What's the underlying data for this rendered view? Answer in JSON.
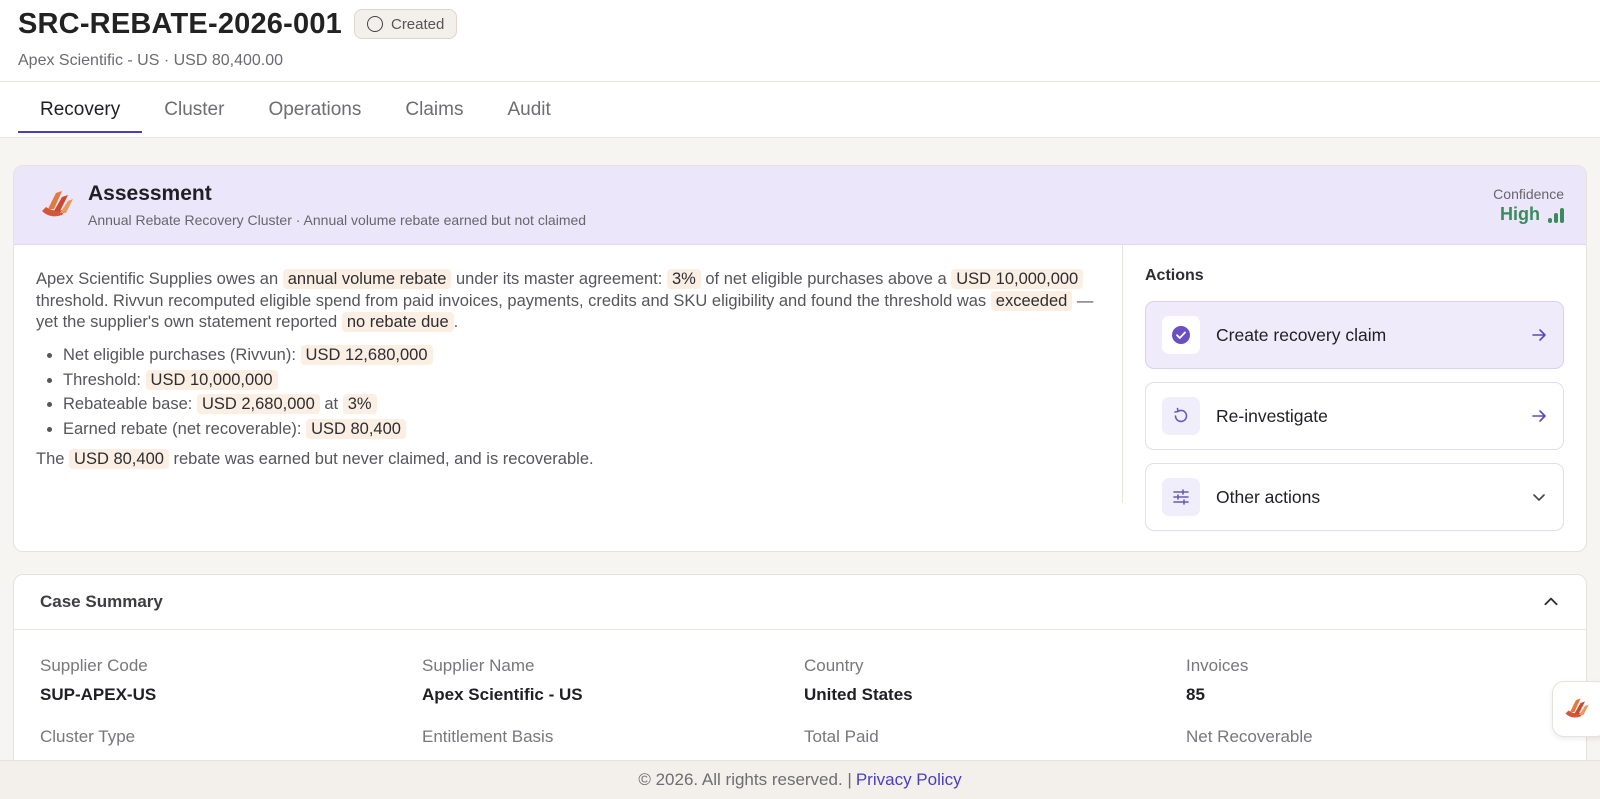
{
  "case": {
    "id": "SRC-REBATE-2026-001",
    "status": "Created",
    "subtitle": "Apex Scientific - US · USD 80,400.00"
  },
  "tabs": [
    "Recovery",
    "Cluster",
    "Operations",
    "Claims",
    "Audit"
  ],
  "assessment": {
    "title": "Assessment",
    "subtitle": "Annual Rebate Recovery Cluster · Annual volume rebate earned but not claimed",
    "confidence_label": "Confidence",
    "confidence_value": "High",
    "para1": {
      "t1": "Apex Scientific Supplies owes an ",
      "h1": "annual volume rebate",
      "t2": " under its master agreement: ",
      "h2": "3%",
      "t3": " of net eligible purchases above a ",
      "h3": "USD 10,000,000",
      "t4": " threshold. Rivvun recomputed eligible spend from paid invoices, payments, credits and SKU eligibility and found the threshold was ",
      "h4": "exceeded",
      "t5": " — yet the supplier's own statement reported ",
      "h5": "no rebate due",
      "t6": "."
    },
    "bullets": [
      {
        "label": "Net eligible purchases (Rivvun): ",
        "value": "USD 12,680,000"
      },
      {
        "label": "Threshold: ",
        "value": "USD 10,000,000"
      },
      {
        "label": "Rebateable base: ",
        "value": "USD 2,680,000",
        "mid": " at ",
        "value2": "3%"
      },
      {
        "label": "Earned rebate (net recoverable): ",
        "value": "USD 80,400"
      }
    ],
    "para2": {
      "t1": "The ",
      "h1": "USD 80,400",
      "t2": " rebate was earned but never claimed, and is recoverable."
    },
    "actions_label": "Actions",
    "actions": [
      {
        "label": "Create recovery claim"
      },
      {
        "label": "Re-investigate"
      },
      {
        "label": "Other actions"
      }
    ]
  },
  "summary": {
    "title": "Case Summary",
    "fields": [
      {
        "label": "Supplier Code",
        "value": "SUP-APEX-US"
      },
      {
        "label": "Supplier Name",
        "value": "Apex Scientific - US"
      },
      {
        "label": "Country",
        "value": "United States"
      },
      {
        "label": "Invoices",
        "value": "85"
      },
      {
        "label": "Cluster Type",
        "value": ""
      },
      {
        "label": "Entitlement Basis",
        "value": ""
      },
      {
        "label": "Total Paid",
        "value": ""
      },
      {
        "label": "Net Recoverable",
        "value": ""
      }
    ]
  },
  "footer": {
    "copyright": "© 2026. All rights reserved. |",
    "privacy": "Privacy Policy"
  },
  "colors": {
    "accent": "#4b3fbf",
    "confidence_high": "#3a8b5c",
    "highlight_bg": "#fbeee2",
    "assessment_header_bg": "#ece6fa"
  }
}
